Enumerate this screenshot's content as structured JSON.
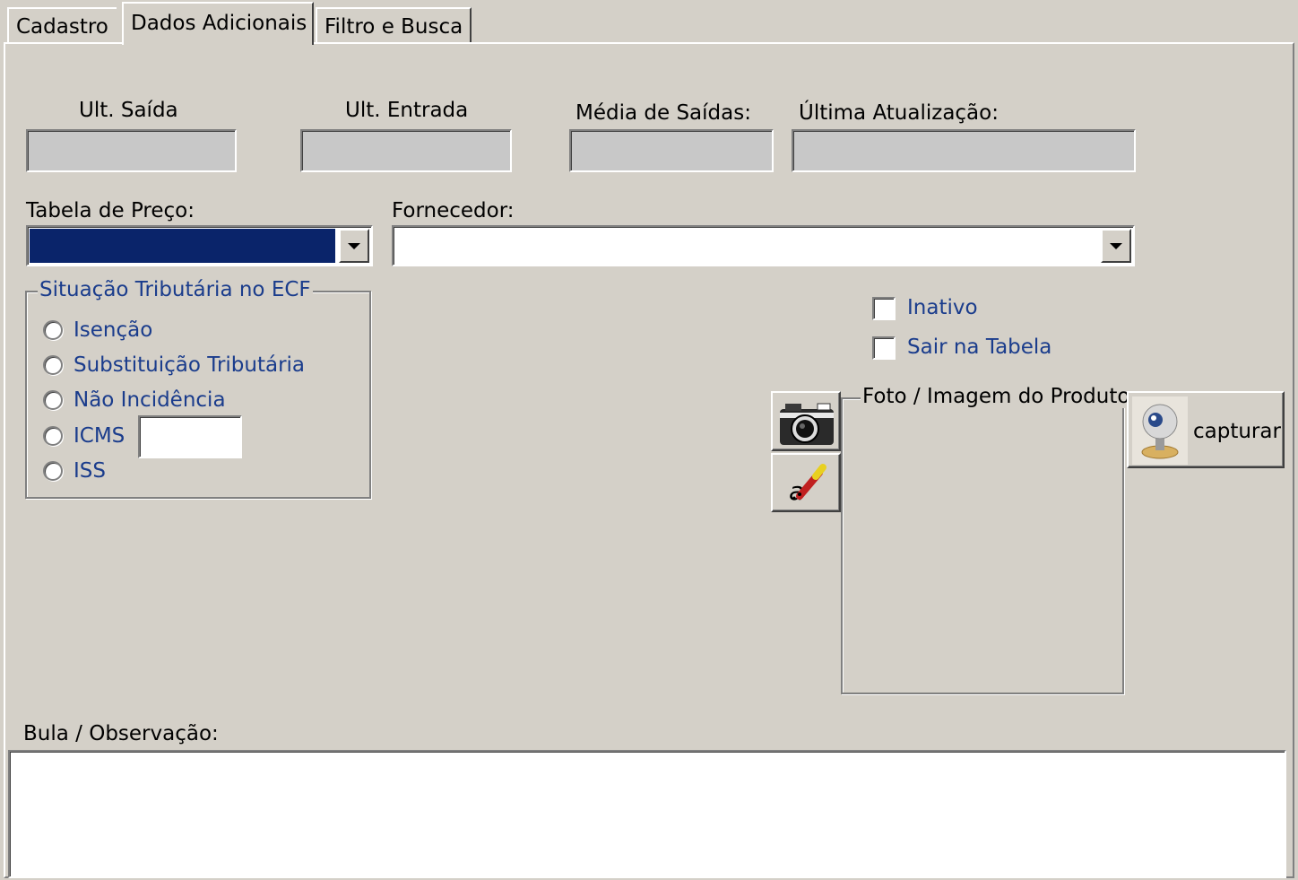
{
  "tabs": [
    {
      "label": "Cadastro",
      "active": false
    },
    {
      "label": "Dados Adicionais",
      "active": true
    },
    {
      "label": "Filtro e Busca",
      "active": false
    }
  ],
  "stats": {
    "ult_saida_label": "Ult. Saída",
    "ult_entrada_label": "Ult. Entrada",
    "media_saidas_label": "Média de Saídas:",
    "ultima_atualizacao_label": "Última Atualização:",
    "ult_saida_value": "",
    "ult_entrada_value": "",
    "media_saidas_value": "",
    "ultima_atualizacao_value": ""
  },
  "tabela_preco": {
    "label": "Tabela de Preço:",
    "value": "",
    "selected_color": "#0a246a"
  },
  "fornecedor": {
    "label": "Fornecedor:",
    "value": ""
  },
  "situacao": {
    "legend": "Situação Tributária no ECF",
    "options": [
      "Isenção",
      "Substituição Tributária",
      "Não Incidência",
      "ICMS",
      "ISS"
    ],
    "icms_value": ""
  },
  "checkboxes": {
    "inativo": "Inativo",
    "sair_tabela": "Sair na Tabela"
  },
  "foto": {
    "legend": "Foto / Imagem do Produto",
    "capture_label": "capturar"
  },
  "icons": {
    "camera": "camera-icon",
    "eraser": "eraser-icon",
    "webcam": "webcam-icon"
  },
  "bula": {
    "label": "Bula / Observação:",
    "value": ""
  },
  "colors": {
    "face": "#d4d0c8",
    "label_blue": "#1a3c8c"
  }
}
